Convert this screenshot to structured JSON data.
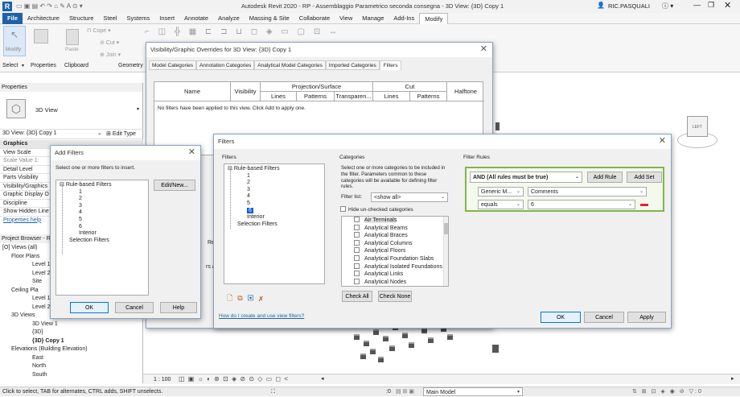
{
  "app": {
    "title": "Autodesk Revit 2020 - RP - Assemblaggio Parametrico seconda consegna - 3D View: {3D} Copy 1",
    "user": "RIC.PASQUALI"
  },
  "menu": [
    "File",
    "Architecture",
    "Structure",
    "Steel",
    "Systems",
    "Insert",
    "Annotate",
    "Analyze",
    "Massing & Site",
    "Collaborate",
    "View",
    "Manage",
    "Add-Ins",
    "Modify"
  ],
  "ribbon": {
    "modify": "Modify",
    "select": "Select",
    "properties": "Properties",
    "clipboard": "Clipboard",
    "geometry": "Geometry",
    "cope": "Cope",
    "cut": "Cut",
    "join": "Join",
    "paste": "Paste"
  },
  "properties": {
    "title": "Properties",
    "type_name": "3D View",
    "selector": "3D View: {3D} Copy 1",
    "edit_type": "Edit Type",
    "rows": [
      "Graphics",
      "View Scale",
      "Scale Value    1:",
      "Detail Level",
      "Parts Visibility",
      "Visibility/Graphics",
      "Graphic Display O",
      "Discipline",
      "Show Hidden Line"
    ],
    "help": "Properties help"
  },
  "browser": {
    "title": "Project Browser - R",
    "rows": [
      "[O] Views (all)",
      "Floor Plans",
      "Level 1",
      "Level 2",
      "Site",
      "Ceiling Pla",
      "Level 1",
      "Level 2",
      "3D Views",
      "3D View 1",
      "{3D}",
      "{3D} Copy 1",
      "Elevations (Building Elevation)",
      "East",
      "North",
      "South"
    ]
  },
  "viewbar": {
    "scale": "1 : 100",
    "model": "Main Model"
  },
  "status": {
    "text": "Click to select, TAB for alternates, CTRL adds, SHIFT unselects.",
    "coord": ":0"
  },
  "vg": {
    "title": "Visibility/Graphic Overrides for 3D View: {3D} Copy 1",
    "tabs": [
      "Model Categories",
      "Annotation Categories",
      "Analytical Model Categories",
      "Imported Categories",
      "Filters"
    ],
    "headers": {
      "name": "Name",
      "visibility": "Visibility",
      "projection": "Projection/Surface",
      "cut": "Cut",
      "halftone": "Halftone",
      "lines": "Lines",
      "patterns": "Patterns",
      "transparency": "Transparen...",
      "cut_lines": "Lines",
      "cut_patterns": "Patterns"
    },
    "empty": "No filters have been applied to this view. Click Add to apply one.",
    "peek": "Re",
    "peek2": "rs are"
  },
  "add_filters": {
    "title": "Add Filters",
    "prompt": "Select one or more filters to insert.",
    "tree": [
      "Rule-based Filters",
      "1",
      "2",
      "3",
      "4",
      "5",
      "6",
      "Interior",
      "Selection Filters"
    ],
    "edit": "Edit/New...",
    "ok": "OK",
    "cancel": "Cancel",
    "help": "Help"
  },
  "filters": {
    "title": "Filters",
    "filters_label": "Filters",
    "tree": [
      "Rule-based Filters",
      "1",
      "2",
      "3",
      "4",
      "5",
      "6",
      "Interior",
      "Selection Filters"
    ],
    "categories_label": "Categories",
    "categories_desc": "Select one or more categories to be included in the filter.  Parameters common to these categories will be available for defining filter rules.",
    "filter_list_label": "Filter list:",
    "filter_list_value": "<show all>",
    "hide_unchecked": "Hide un-checked categories",
    "categories": [
      "Air Terminals",
      "Analytical Beams",
      "Analytical Braces",
      "Analytical Columns",
      "Analytical Floors",
      "Analytical Foundation Slabs",
      "Analytical Isolated Foundations",
      "Analytical Links",
      "Analytical Nodes"
    ],
    "check_all": "Check All",
    "check_none": "Check None",
    "rules_label": "Filter Rules",
    "rule_group": "AND (All rules must be true)",
    "add_rule": "Add Rule",
    "add_set": "Add Set",
    "rule_field1": "Generic M...",
    "rule_param": "Comments",
    "rule_operator": "equals",
    "rule_value": "6",
    "help_link": "How do I create and use view filters?",
    "ok": "OK",
    "cancel": "Cancel",
    "apply": "Apply"
  },
  "viewcube": "LEFT"
}
